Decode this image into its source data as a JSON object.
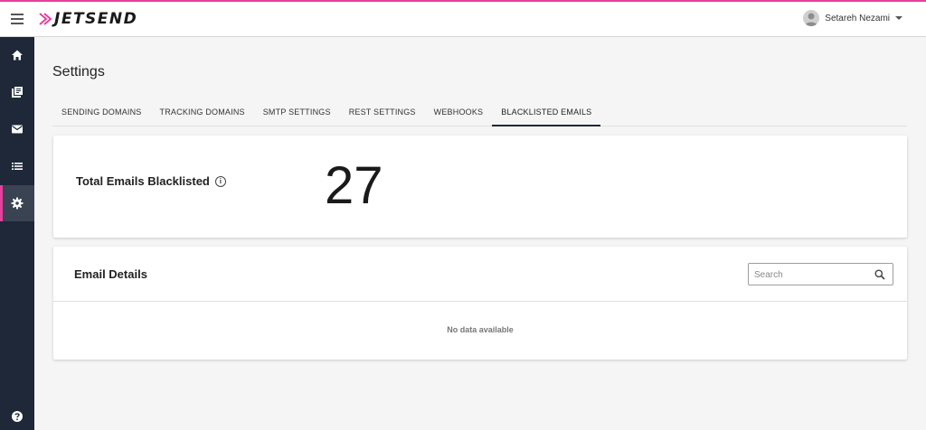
{
  "brand": {
    "name": "JETSEND",
    "accent_color": "#e6409c",
    "sidebar_color": "#1e2838"
  },
  "header": {
    "user_name": "Setareh Nezami"
  },
  "sidebar": {
    "items": [
      {
        "icon": "home-icon"
      },
      {
        "icon": "library-icon"
      },
      {
        "icon": "mail-icon"
      },
      {
        "icon": "list-icon"
      },
      {
        "icon": "gear-icon",
        "active": true
      },
      {
        "icon": "help-icon"
      }
    ]
  },
  "page": {
    "title": "Settings"
  },
  "tabs": [
    {
      "label": "SENDING DOMAINS"
    },
    {
      "label": "TRACKING DOMAINS"
    },
    {
      "label": "SMTP SETTINGS"
    },
    {
      "label": "REST SETTINGS"
    },
    {
      "label": "WEBHOOKS"
    },
    {
      "label": "BLACKLISTED EMAILS",
      "active": true
    }
  ],
  "summary": {
    "label": "Total Emails Blacklisted",
    "count": "27"
  },
  "details": {
    "title": "Email Details",
    "search_placeholder": "Search",
    "empty_message": "No data available"
  }
}
